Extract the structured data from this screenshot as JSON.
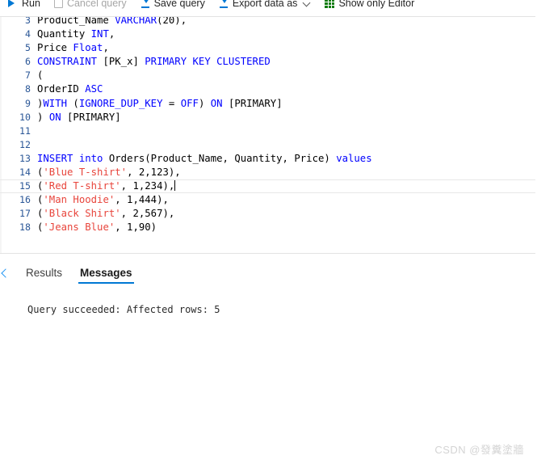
{
  "toolbar": {
    "items": [
      {
        "label": "Run",
        "icon": "run-play-icon",
        "disabled": false
      },
      {
        "label": "Cancel query",
        "icon": "stop-square-icon",
        "disabled": true
      },
      {
        "label": "Save query",
        "icon": "download-arrow-icon",
        "disabled": false
      },
      {
        "label": "Export data as",
        "icon": "download-arrow-icon",
        "disabled": false,
        "chevron": "chevron-down-icon"
      },
      {
        "label": "Show only Editor",
        "icon": "grid-green-icon",
        "disabled": false
      }
    ]
  },
  "editor": {
    "language": "sql",
    "cursor_line": 15,
    "lines": [
      {
        "number": "3",
        "tokens": [
          {
            "t": "Product_Name ",
            "c": "txt"
          },
          {
            "t": "VARCHAR",
            "c": "kw"
          },
          {
            "t": "(",
            "c": "txt"
          },
          {
            "t": "20",
            "c": "num"
          },
          {
            "t": "),",
            "c": "txt"
          }
        ]
      },
      {
        "number": "4",
        "tokens": [
          {
            "t": "Quantity ",
            "c": "txt"
          },
          {
            "t": "INT",
            "c": "kw"
          },
          {
            "t": ",",
            "c": "txt"
          }
        ]
      },
      {
        "number": "5",
        "tokens": [
          {
            "t": "Price ",
            "c": "txt"
          },
          {
            "t": "Float",
            "c": "kw"
          },
          {
            "t": ",",
            "c": "txt"
          }
        ]
      },
      {
        "number": "6",
        "tokens": [
          {
            "t": "CONSTRAINT",
            "c": "kw"
          },
          {
            "t": " [PK_x] ",
            "c": "txt"
          },
          {
            "t": "PRIMARY KEY CLUSTERED",
            "c": "kw"
          }
        ]
      },
      {
        "number": "7",
        "tokens": [
          {
            "t": "(",
            "c": "txt"
          }
        ]
      },
      {
        "number": "8",
        "tokens": [
          {
            "t": "OrderID ",
            "c": "txt"
          },
          {
            "t": "ASC",
            "c": "kw"
          }
        ]
      },
      {
        "number": "9",
        "tokens": [
          {
            "t": ")",
            "c": "txt"
          },
          {
            "t": "WITH",
            "c": "kw"
          },
          {
            "t": " (",
            "c": "txt"
          },
          {
            "t": "IGNORE_DUP_KEY",
            "c": "kw"
          },
          {
            "t": " = ",
            "c": "txt"
          },
          {
            "t": "OFF",
            "c": "kw"
          },
          {
            "t": ") ",
            "c": "txt"
          },
          {
            "t": "ON",
            "c": "kw"
          },
          {
            "t": " [PRIMARY]",
            "c": "txt"
          }
        ]
      },
      {
        "number": "10",
        "tokens": [
          {
            "t": ") ",
            "c": "txt"
          },
          {
            "t": "ON",
            "c": "kw"
          },
          {
            "t": " [PRIMARY]",
            "c": "txt"
          }
        ]
      },
      {
        "number": "11",
        "tokens": [
          {
            "t": "",
            "c": "txt"
          }
        ]
      },
      {
        "number": "12",
        "tokens": [
          {
            "t": "",
            "c": "txt"
          }
        ]
      },
      {
        "number": "13",
        "tokens": [
          {
            "t": "INSERT",
            "c": "kw"
          },
          {
            "t": " ",
            "c": "txt"
          },
          {
            "t": "into",
            "c": "kw"
          },
          {
            "t": " Orders(Product_Name, Quantity, Price) ",
            "c": "txt"
          },
          {
            "t": "values",
            "c": "kw"
          }
        ]
      },
      {
        "number": "14",
        "tokens": [
          {
            "t": "(",
            "c": "txt"
          },
          {
            "t": "'Blue T-shirt'",
            "c": "str"
          },
          {
            "t": ", 2,123),",
            "c": "txt"
          }
        ]
      },
      {
        "number": "15",
        "current": true,
        "caret": true,
        "tokens": [
          {
            "t": "(",
            "c": "txt"
          },
          {
            "t": "'Red T-shirt'",
            "c": "str"
          },
          {
            "t": ", 1,234),",
            "c": "txt"
          }
        ]
      },
      {
        "number": "16",
        "tokens": [
          {
            "t": "(",
            "c": "txt"
          },
          {
            "t": "'Man Hoodie'",
            "c": "str"
          },
          {
            "t": ", 1,444),",
            "c": "txt"
          }
        ]
      },
      {
        "number": "17",
        "tokens": [
          {
            "t": "(",
            "c": "txt"
          },
          {
            "t": "'Black Shirt'",
            "c": "str"
          },
          {
            "t": ", 2,567),",
            "c": "txt"
          }
        ]
      },
      {
        "number": "18",
        "tokens": [
          {
            "t": "(",
            "c": "txt"
          },
          {
            "t": "'Jeans Blue'",
            "c": "str"
          },
          {
            "t": ", 1,90)",
            "c": "txt"
          }
        ]
      }
    ]
  },
  "results_pane": {
    "collapse_icon": "chevron-left-icon",
    "tabs": [
      {
        "label": "Results",
        "active": false
      },
      {
        "label": "Messages",
        "active": true
      }
    ],
    "message": "Query succeeded: Affected rows: 5"
  },
  "watermark": {
    "text": "CSDN @發糞塗牆"
  },
  "colors": {
    "accent": "#0078d4",
    "keyword": "#0000ff",
    "string": "#e8453c",
    "line_number": "#2b5797",
    "green_icon": "#107c10"
  }
}
